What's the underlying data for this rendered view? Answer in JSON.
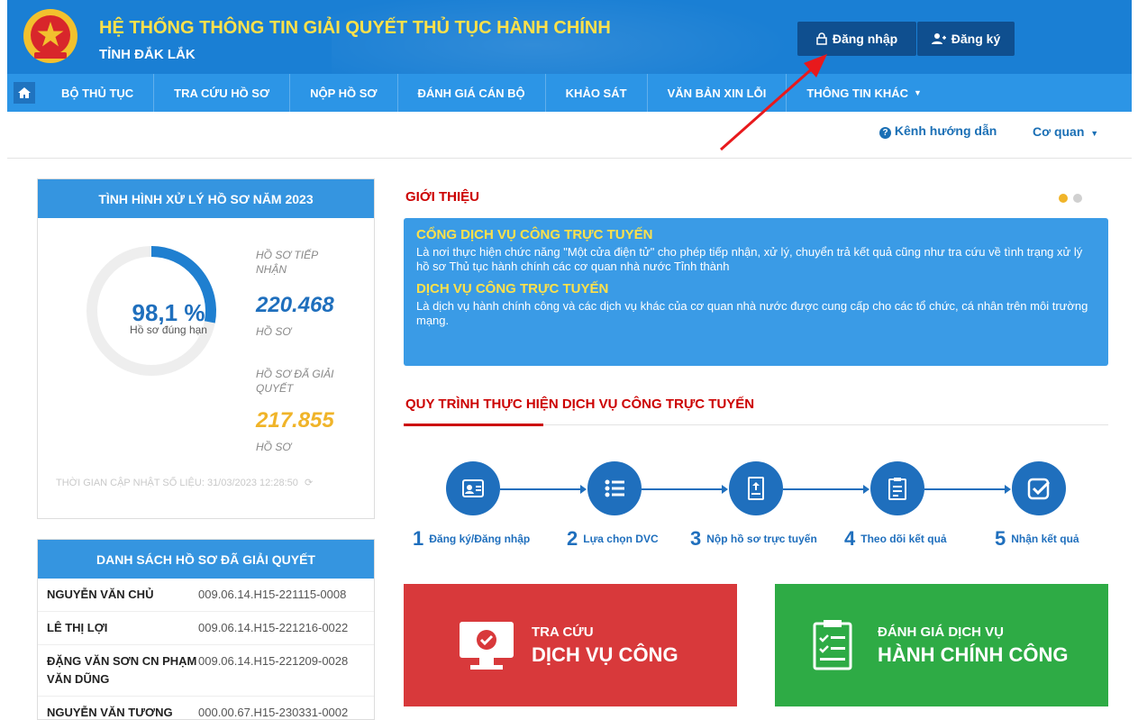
{
  "header": {
    "title": "HỆ THỐNG THÔNG TIN GIẢI QUYẾT THỦ TỤC HÀNH CHÍNH",
    "subtitle": "TỈNH ĐẮK LẮK",
    "login_label": "Đăng nhập",
    "register_label": "Đăng ký"
  },
  "nav": {
    "items": [
      {
        "label": "BỘ THỦ TỤC"
      },
      {
        "label": "TRA CỨU HỒ SƠ"
      },
      {
        "label": "NỘP HỒ SƠ"
      },
      {
        "label": "ĐÁNH GIÁ CÁN BỘ"
      },
      {
        "label": "KHẢO SÁT"
      },
      {
        "label": "VĂN BẢN XIN LỖI"
      },
      {
        "label": "THÔNG TIN KHÁC"
      }
    ]
  },
  "subbar": {
    "guide_label": "Kênh hướng dẫn",
    "agency_label": "Cơ quan"
  },
  "stats": {
    "title": "TÌNH HÌNH XỬ LÝ HỒ SƠ NĂM 2023",
    "percent_text": "98,1 %",
    "percent_value": 98.1,
    "percent_label": "Hồ sơ đúng hạn",
    "received_label": "HỒ SƠ TIẾP NHẬN",
    "received_value": "220.468",
    "received_unit": "HỒ SƠ",
    "resolved_label": "HỒ SƠ ĐÃ GIẢI QUYẾT",
    "resolved_value": "217.855",
    "resolved_unit": "HỒ SƠ",
    "updated_text": "THỜI GIAN CẬP NHẬT SỐ LIỆU: 31/03/2023 12:28:50",
    "colors": {
      "received": "#1f6fbd",
      "resolved": "#f0b429"
    }
  },
  "resolved_list": {
    "title": "DANH SÁCH HỒ SƠ ĐÃ GIẢI QUYẾT",
    "rows": [
      {
        "name": "NGUYỄN VĂN CHỦ",
        "code": "009.06.14.H15-221115-0008"
      },
      {
        "name": "LÊ THỊ LỢI",
        "code": "009.06.14.H15-221216-0022"
      },
      {
        "name": "ĐẶNG VĂN SƠN CN PHẠM VĂN DŨNG",
        "code": "009.06.14.H15-221209-0028"
      },
      {
        "name": "NGUYỄN VĂN TƯƠNG",
        "code": "000.00.67.H15-230331-0002"
      }
    ]
  },
  "intro": {
    "title": "GIỚI THIỆU",
    "h1": "CỔNG DỊCH VỤ CÔNG TRỰC TUYẾN",
    "p1": "Là nơi thực hiện chức năng \"Một cửa điện tử\" cho phép tiếp nhận, xử lý, chuyển trả kết quả cũng như tra cứu về tình trạng xử lý hồ sơ Thủ tục hành chính các cơ quan nhà nước Tỉnh thành",
    "h2": "DỊCH VỤ CÔNG TRỰC TUYẾN",
    "p2": "Là dịch vụ hành chính công và các dịch vụ khác của cơ quan nhà nước được cung cấp cho các tổ chức, cá nhân trên môi trường mạng.",
    "dot_colors": [
      "#f0b429",
      "#d0d0d0"
    ]
  },
  "process": {
    "title": "QUY TRÌNH THỰC HIỆN DỊCH VỤ CÔNG TRỰC TUYẾN",
    "steps": [
      {
        "num": "1",
        "label": "Đăng ký/Đăng nhập",
        "icon": "id-card-icon"
      },
      {
        "num": "2",
        "label": "Lựa chọn DVC",
        "icon": "list-icon"
      },
      {
        "num": "3",
        "label": "Nộp hồ sơ trực tuyến",
        "icon": "upload-document-icon"
      },
      {
        "num": "4",
        "label": "Theo dõi kết quả",
        "icon": "clipboard-icon"
      },
      {
        "num": "5",
        "label": "Nhận kết quả",
        "icon": "check-square-icon"
      }
    ]
  },
  "actions": {
    "lookup_line1": "TRA CỨU",
    "lookup_line2": "DỊCH VỤ CÔNG",
    "eval_line1": "ĐÁNH GIÁ DỊCH VỤ",
    "eval_line2": "HÀNH CHÍNH CÔNG",
    "lookup_color": "#d8393b",
    "eval_color": "#2eab45"
  },
  "annotation_color": "#e8191c"
}
